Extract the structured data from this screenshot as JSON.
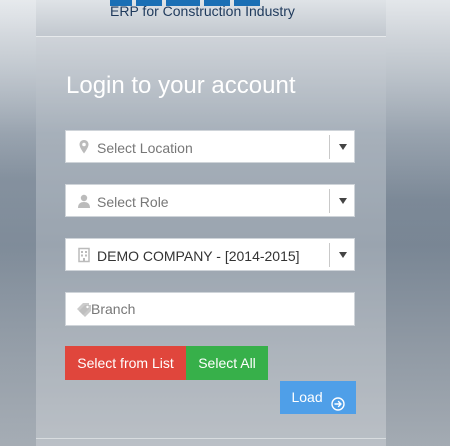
{
  "header": {
    "tagline": "ERP for Construction Industry"
  },
  "login": {
    "title": "Login to your account",
    "location": {
      "placeholder": "Select Location",
      "icon": "map-marker-icon"
    },
    "role": {
      "placeholder": "Select Role",
      "icon": "user-icon"
    },
    "company": {
      "selected": "DEMO COMPANY - [2014-2015]",
      "icon": "building-icon"
    },
    "branch": {
      "placeholder": "Branch",
      "value": "",
      "icon": "tags-icon"
    },
    "buttons": {
      "select_from_list": "Select from List",
      "select_all": "Select All",
      "load": "Load"
    }
  },
  "colors": {
    "logo": "#1a6fb5",
    "select_from_list": "#e0463c",
    "select_all": "#37b04a",
    "load": "#4f9fe8"
  }
}
